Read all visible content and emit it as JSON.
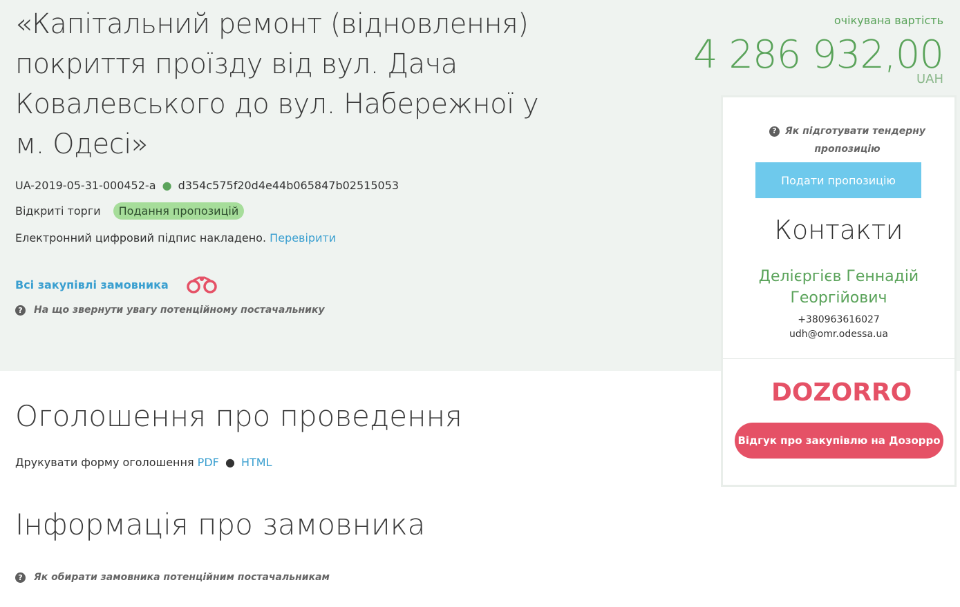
{
  "tender": {
    "title": "«Капітальний ремонт (відновлення) покриття проїзду від вул. Дача Ковалевського до вул. Набережної у м. Одесі»",
    "id": "UA-2019-05-31-000452-a",
    "separator": "●",
    "hash": "d354c575f20d4e44b065847b02515053",
    "procedure": "Відкриті торги",
    "status": "Подання пропозицій",
    "signature_text": "Електронний цифровий підпис накладено.",
    "verify_link": "Перевірити",
    "all_purchases_link": "Всі закупівлі замовника",
    "supplier_hint": "На що звернути увагу потенційному постачальнику"
  },
  "expected_value": {
    "label": "очікувана вартість",
    "amount": "4 286 932,00",
    "currency": "UAH"
  },
  "sidebar": {
    "bid_hint": "Як підготувати тендерну пропозицію",
    "submit_label": "Подати пропозицію",
    "contacts_title": "Контакти",
    "contact_name": "Делієргієв Геннадій Георгійович",
    "phone": "+380963616027",
    "email": "udh@omr.odessa.ua",
    "dozorro_logo": "DOZORRO",
    "dozorro_button": "Відгук про закупівлю на Дозорро"
  },
  "sections": {
    "announcement_title": "Оголошення про проведення",
    "print_label": "Друкувати форму оголошення",
    "pdf_link": "PDF",
    "html_link": "HTML",
    "separator": "●",
    "customer_info_title": "Інформація про замовника",
    "customer_hint": "Як обирати замовника потенційним постачальникам"
  },
  "icons": {
    "question": "question-circle-icon",
    "binoculars": "binoculars-icon"
  },
  "colors": {
    "band": "#eff3f0",
    "green": "#5aa35a",
    "link": "#3a9fd0",
    "submit": "#6ec9ec",
    "dozorro": "#e55166",
    "badge": "#a6dd9a"
  }
}
